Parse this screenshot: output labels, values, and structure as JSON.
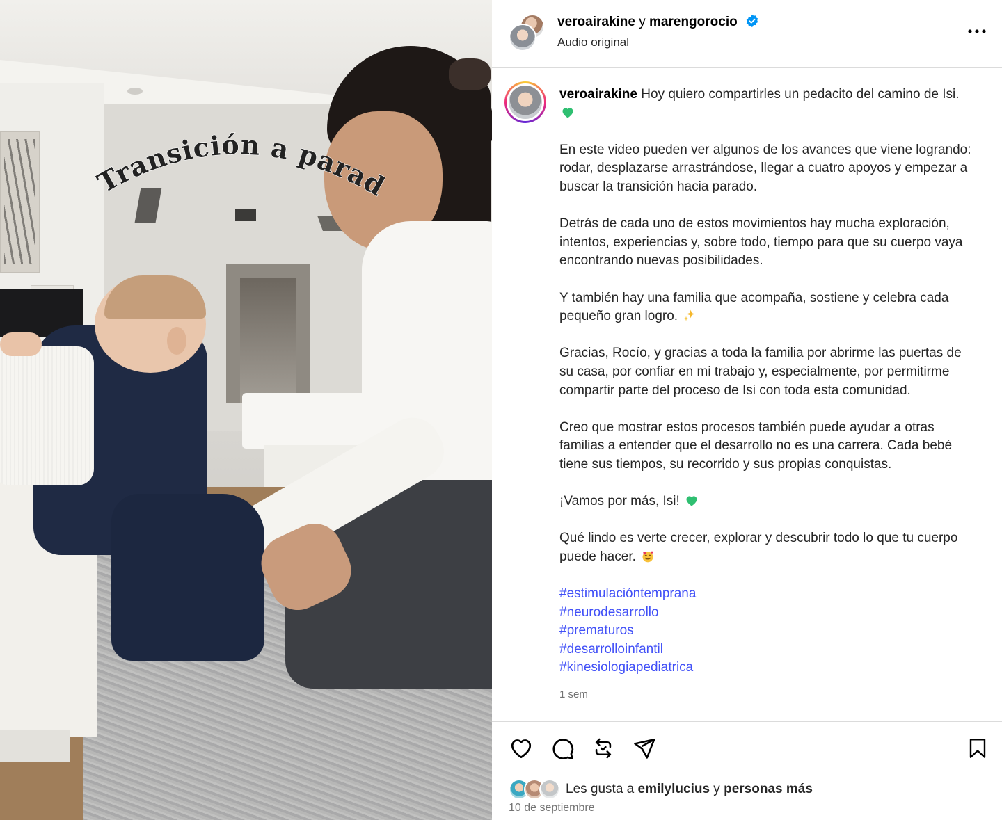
{
  "media": {
    "overlay_text": "Transición a parado."
  },
  "header": {
    "author1": "veroairakine",
    "connector": " y ",
    "author2": "marengorocio",
    "audio": "Audio original",
    "more_icon": "more-horizontal-icon"
  },
  "caption": {
    "username": "veroairakine",
    "intro": " Hoy quiero compartirles un pedacito del camino de Isi.",
    "paragraphs": [
      "En este video pueden ver algunos de los avances que viene logrando: rodar, desplazarse arrastrándose, llegar a cuatro apoyos y empezar a buscar la transición hacia parado.",
      "Detrás de cada uno de estos movimientos hay mucha exploración, intentos, experiencias y, sobre todo, tiempo para que su cuerpo vaya encontrando nuevas posibilidades.",
      "Y también hay una familia que acompaña, sostiene y celebra cada pequeño gran logro.",
      "Gracias, Rocío, y gracias a toda la familia por abrirme las puertas de su casa, por confiar en mi trabajo y, especialmente, por permitirme compartir parte del proceso de Isi con toda esta comunidad.",
      "Creo que mostrar estos procesos también puede ayudar a otras familias a entender que el desarrollo no es una carrera. Cada bebé tiene sus tiempos, su recorrido y sus propias conquistas.",
      "¡Vamos por más, Isi!",
      "Qué lindo es verte crecer, explorar y descubrir todo lo que tu cuerpo puede hacer."
    ],
    "hashtags": [
      "#estimulacióntemprana",
      "#neurodesarrollo",
      "#prematuros",
      "#desarrolloinfantil",
      "#kinesiologiapediatrica"
    ],
    "time_ago": "1 sem"
  },
  "actions": {
    "icons": [
      "heart-icon",
      "comment-icon",
      "repost-icon",
      "share-icon",
      "bookmark-icon"
    ],
    "likes_prefix": "Les gusta a ",
    "likes_user": "emilylucius",
    "likes_connector": " y ",
    "likes_others": "personas más",
    "date": "10 de septiembre"
  },
  "colors": {
    "hashtag": "#4150f7",
    "verified": "#0095f6",
    "green_heart": "#2fbf71"
  }
}
